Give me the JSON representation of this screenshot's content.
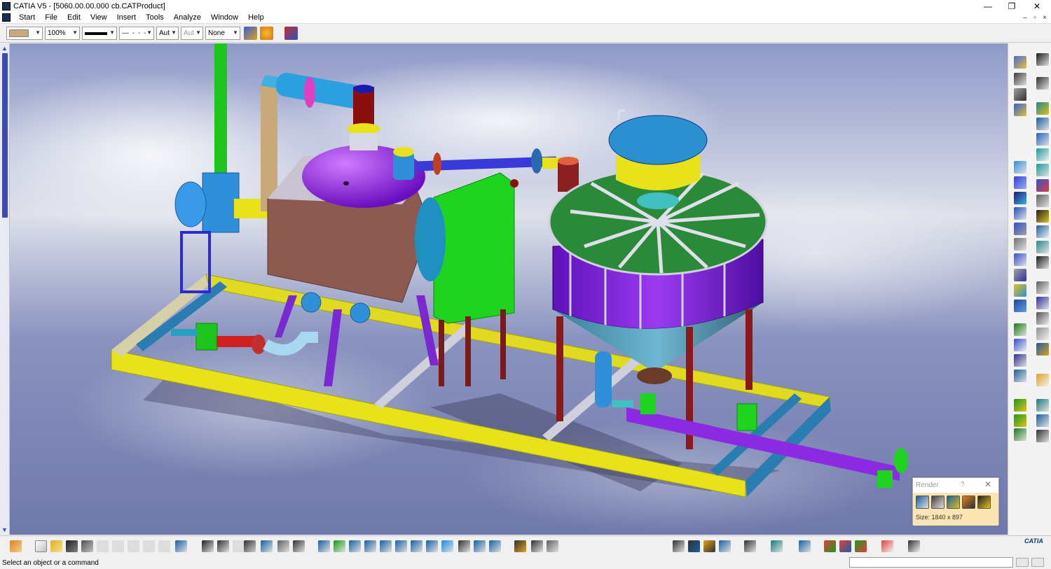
{
  "window": {
    "title": "CATIA V5 - [5060.00.00.000 cb.CATProduct]",
    "controls": {
      "minimize": "—",
      "maximize": "❐",
      "close": "✕"
    },
    "mdi_controls": {
      "minimize": "–",
      "restore": "▫",
      "close": "×"
    }
  },
  "menubar": {
    "items": [
      {
        "label": "Start"
      },
      {
        "label": "File"
      },
      {
        "label": "Edit"
      },
      {
        "label": "View"
      },
      {
        "label": "Insert"
      },
      {
        "label": "Tools"
      },
      {
        "label": "Analyze"
      },
      {
        "label": "Window"
      },
      {
        "label": "Help"
      }
    ]
  },
  "properties_toolbar": {
    "transparency": "100%",
    "thickness_auto": "Aut",
    "point_auto": "Aut",
    "layer": "None",
    "fill_color": "#c8aa7a"
  },
  "render_panel": {
    "title": "Render",
    "help": "?",
    "close": "✕",
    "size_label": "Size: 1840 x 897"
  },
  "statusbar": {
    "message": "Select an object or a command"
  },
  "logo": {
    "label": "CATIA"
  },
  "colors": {
    "sky": "#7c86b8",
    "frame_yellow": "#e8e21a",
    "vessel_purple": "#8a2be2",
    "box_brown": "#8c5a50",
    "green": "#1fd41f",
    "deck_green": "#2a8a3a",
    "tank_blue": "#2f8fd8",
    "pipe_blue": "#3a3ad8"
  }
}
